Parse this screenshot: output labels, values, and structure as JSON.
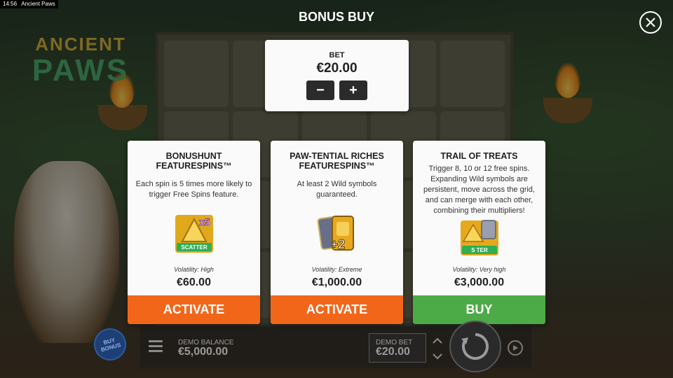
{
  "system_bar": {
    "time": "14:56",
    "app_name": "Ancient Paws"
  },
  "game_logo": {
    "line1": "ANCIENT",
    "line2": "PAWS"
  },
  "modal": {
    "title": "BONUS BUY",
    "close_icon": "close-icon"
  },
  "bet": {
    "label": "BET",
    "value": "€20.00",
    "decrease_label": "−",
    "increase_label": "+"
  },
  "features": [
    {
      "title": "BONUSHUNT FEATURESPINS™",
      "description": "Each spin is 5 times more likely to trigger Free Spins feature.",
      "image_text": "SCATTER",
      "image_badge": "x5",
      "volatility": "Volatility: High",
      "price": "€60.00",
      "button_label": "ACTIVATE",
      "button_color": "#f2661a"
    },
    {
      "title": "PAW-TENTIAL RICHES FEATURESPINS™",
      "description": "At least 2 Wild symbols guaranteed.",
      "image_badge": "+2",
      "volatility": "Volatility: Extreme",
      "price": "€1,000.00",
      "button_label": "ACTIVATE",
      "button_color": "#f2661a"
    },
    {
      "title": "TRAIL OF TREATS",
      "description": "Trigger 8, 10 or 12 free spins. Expanding Wild symbols are persistent, move across the grid, and can merge with each other, combining their multipliers!",
      "image_text": "S  TER",
      "volatility": "Volatility: Very high",
      "price": "€3,000.00",
      "button_label": "BUY",
      "button_color": "#4caa47"
    }
  ],
  "bottom_bar": {
    "buy_bonus_label": "BUY BONUS",
    "balance_label": "DEMO BALANCE",
    "balance_value": "€5,000.00",
    "bet_label": "DEMO BET",
    "bet_value": "€20.00"
  },
  "colors": {
    "activate": "#f2661a",
    "buy": "#4caa47",
    "card_bg": "#fafafa"
  }
}
